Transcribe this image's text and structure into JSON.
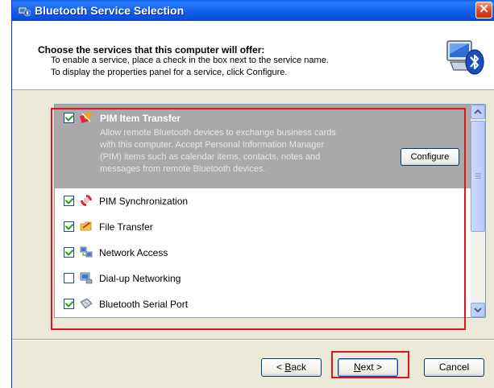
{
  "window": {
    "title": "Bluetooth Service Selection",
    "close_glyph": "✕"
  },
  "header": {
    "title": "Choose the services that this computer will offer:",
    "line1": "To enable a service, place a check in the box next to the service name.",
    "line2": "To display the properties panel for a service, click Configure.",
    "art_icon": "bluetooth-computer-icon"
  },
  "services": {
    "selected": {
      "label": "PIM Item Transfer",
      "checked": true,
      "icon": "pim-transfer-icon",
      "description": "Allow remote Bluetooth devices to exchange business cards with this computer. Accept Personal Information Manager (PIM) items such as calendar items, contacts, notes and messages from remote Bluetooth devices.",
      "configure_label": "Configure"
    },
    "items": [
      {
        "label": "PIM Synchronization",
        "checked": true,
        "icon": "pim-sync-icon"
      },
      {
        "label": "File Transfer",
        "checked": true,
        "icon": "file-transfer-icon"
      },
      {
        "label": "Network Access",
        "checked": true,
        "icon": "network-access-icon"
      },
      {
        "label": "Dial-up Networking",
        "checked": false,
        "icon": "dialup-networking-icon"
      },
      {
        "label": "Bluetooth Serial Port",
        "checked": true,
        "icon": "serial-port-icon"
      }
    ]
  },
  "buttons": {
    "back_access": "B",
    "back_rest": "ack",
    "back_prefix": "< ",
    "next_access": "N",
    "next_rest": "ext >",
    "cancel": "Cancel"
  },
  "colors": {
    "titlebar": "#0a5df2",
    "selection": "#a9a9a9",
    "highlight": "#e0141e",
    "dialog_bg": "#ece9d8"
  }
}
